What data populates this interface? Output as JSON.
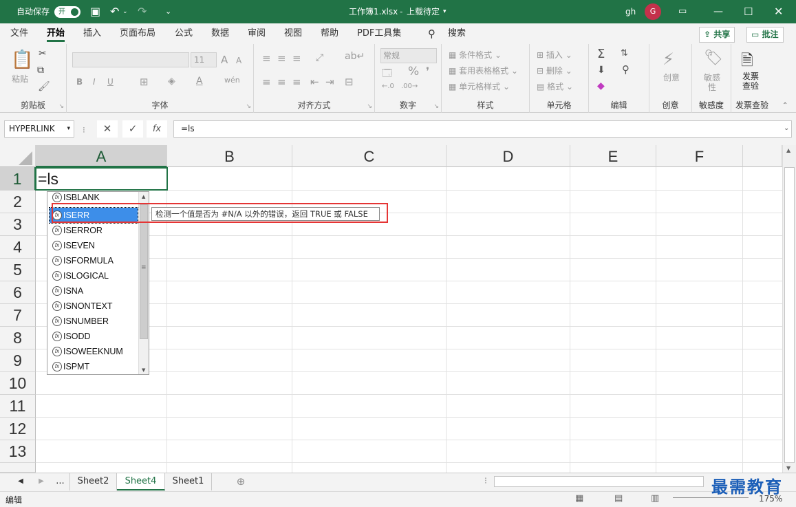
{
  "titlebar": {
    "autosave_label": "自动保存",
    "autosave_state": "开",
    "doc_title": "工作簿1.xlsx",
    "save_status": "上载待定",
    "user_name": "gh",
    "avatar_initial": "G",
    "accent_color": "#217346"
  },
  "menu": {
    "tabs": [
      "文件",
      "开始",
      "插入",
      "页面布局",
      "公式",
      "数据",
      "审阅",
      "视图",
      "帮助",
      "PDF工具集"
    ],
    "active_tab": "开始",
    "search_label": "搜索",
    "share_label": "共享",
    "comments_label": "批注"
  },
  "ribbon": {
    "clipboard": {
      "label": "剪贴板",
      "paste": "粘贴"
    },
    "font": {
      "label": "字体",
      "size": "11",
      "bold": "B",
      "italic": "I",
      "underline": "U",
      "grow": "A",
      "shrink": "A"
    },
    "alignment": {
      "label": "对齐方式"
    },
    "number": {
      "label": "数字",
      "format": "常规",
      "percent": "%"
    },
    "styles": {
      "label": "样式",
      "conditional": "条件格式",
      "table": "套用表格格式",
      "cell_styles": "单元格样式"
    },
    "cells": {
      "label": "单元格",
      "insert": "插入",
      "delete": "删除",
      "format": "格式"
    },
    "editing": {
      "label": "编辑"
    },
    "ideas": {
      "label": "创意",
      "button": "创意"
    },
    "sensitivity": {
      "label": "敏感度",
      "button": "敏感性"
    },
    "invoice": {
      "label": "发票查验",
      "button": "发票查验"
    }
  },
  "formula_bar": {
    "name_box": "HYPERLINK",
    "fx": "fx",
    "content": "=ls"
  },
  "grid": {
    "columns": [
      "A",
      "B",
      "C",
      "D",
      "E",
      "F"
    ],
    "rows": [
      "1",
      "2",
      "3",
      "4",
      "5",
      "6",
      "7",
      "8",
      "9",
      "10",
      "11",
      "12",
      "13"
    ],
    "active_cell_text": "=ls"
  },
  "autocomplete": {
    "items": [
      "ISBLANK",
      "ISERR",
      "ISERROR",
      "ISEVEN",
      "ISFORMULA",
      "ISLOGICAL",
      "ISNA",
      "ISNONTEXT",
      "ISNUMBER",
      "ISODD",
      "ISOWEEKNUM",
      "ISPMT"
    ],
    "selected": "ISERR",
    "tooltip": "检测一个值是否为 #N/A 以外的错误，返回 TRUE 或 FALSE"
  },
  "sheets": {
    "more": "...",
    "tabs": [
      "Sheet2",
      "Sheet4",
      "Sheet1"
    ],
    "active": "Sheet4"
  },
  "status": {
    "mode": "编辑",
    "zoom": "175%"
  },
  "watermark": "最需教育"
}
